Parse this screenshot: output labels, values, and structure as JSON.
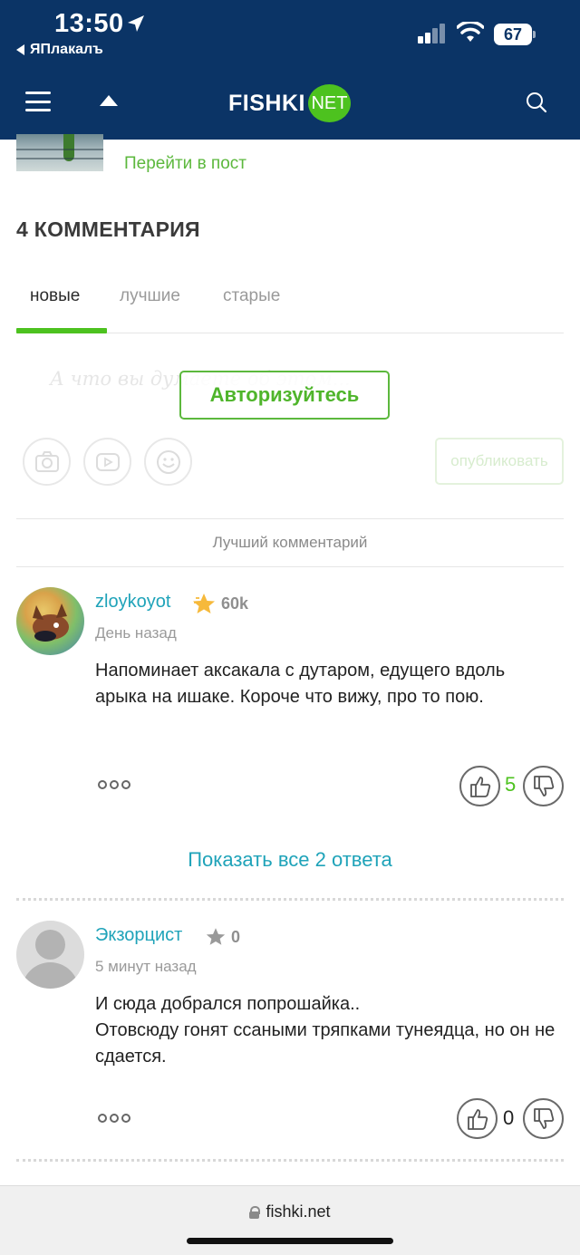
{
  "status_bar": {
    "time": "13:50",
    "battery": "67",
    "back_app": "ЯПлакалъ",
    "icons": [
      "location-arrow-icon",
      "signal-bars-icon",
      "wifi-icon",
      "battery-icon"
    ]
  },
  "header": {
    "logo_text": "FISHKI",
    "logo_badge": "NET",
    "icons": [
      "menu-icon",
      "scroll-up-icon",
      "search-icon"
    ]
  },
  "post": {
    "goto_label": "Перейти в пост"
  },
  "comments_section": {
    "title": "4 КОММЕНТАРИЯ",
    "tabs": [
      "новые",
      "лучшие",
      "старые"
    ],
    "active_tab": "новые"
  },
  "composer": {
    "placeholder": "А что вы думаете об этом...",
    "auth_label": "Авторизуйтесь",
    "publish_label": "опубликовать",
    "tools": [
      "camera-icon",
      "youtube-icon",
      "smiley-icon"
    ]
  },
  "best_comment_label": "Лучший комментарий",
  "comments": [
    {
      "author": "zloykoyot",
      "rating": "60k",
      "time": "День назад",
      "text": "Напоминает аксакала с дутаром, едущего вдоль арыка на ишаке. Короче что вижу, про то пою.",
      "votes": "5",
      "votes_color": "#4dc21f"
    },
    {
      "author": "Экзорцист",
      "rating": "0",
      "time": "5 минут назад",
      "text_lines": [
        "И сюда добрался попрошайка..",
        "Отовсюду гонят ссаными тряпками тунеядца, но он не сдается."
      ],
      "votes": "0",
      "votes_color": "#222222"
    }
  ],
  "show_replies": "Показать все 2 ответа",
  "browser": {
    "url": "fishki.net"
  },
  "colors": {
    "header_bg": "#0b3466",
    "brand_green": "#4dc21f",
    "link_teal": "#1fa3b9"
  }
}
